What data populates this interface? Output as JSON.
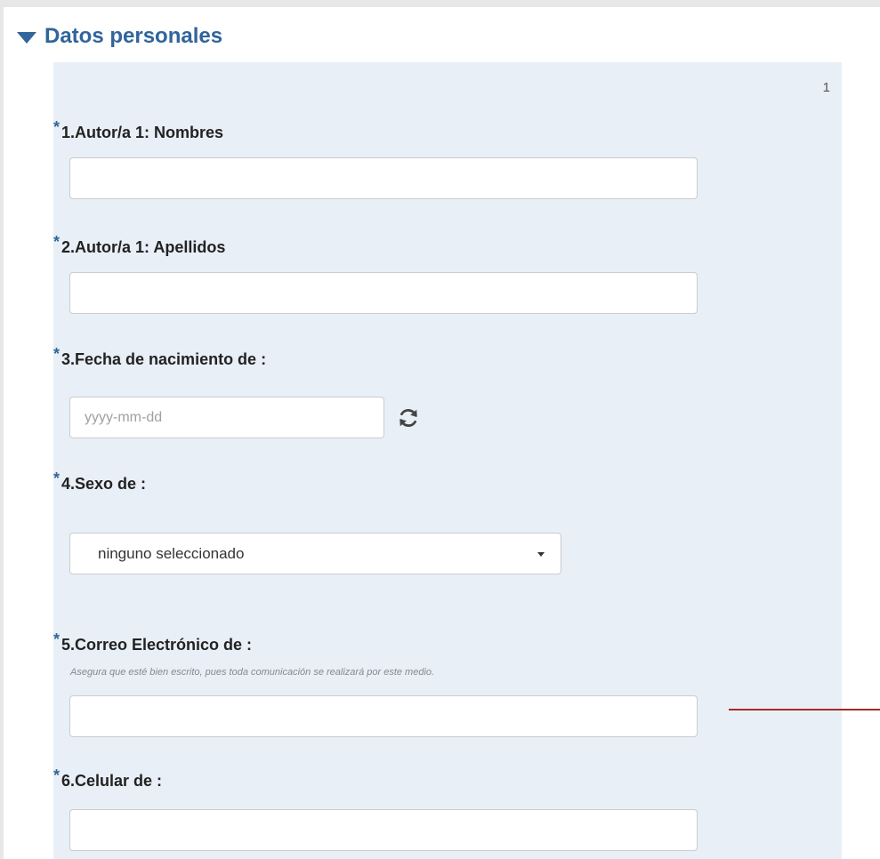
{
  "section": {
    "title": "Datos personales",
    "page_number": "1"
  },
  "questions": {
    "q1": {
      "marker": "*",
      "label": "1.Autor/a 1: Nombres",
      "value": ""
    },
    "q2": {
      "marker": "*",
      "label": "2.Autor/a 1: Apellidos",
      "value": ""
    },
    "q3": {
      "marker": "*",
      "label": "3.Fecha de nacimiento de :",
      "value": "",
      "placeholder": "yyyy-mm-dd"
    },
    "q4": {
      "marker": "*",
      "label": "4.Sexo de :",
      "selected": "ninguno seleccionado"
    },
    "q5": {
      "marker": "*",
      "label": "5.Correo Electrónico de :",
      "help": "Asegura que esté bien escrito, pues toda comunicación se realizará por este medio.",
      "value": ""
    },
    "q6": {
      "marker": "*",
      "label": "6.Celular de :",
      "value": ""
    }
  },
  "icons": {
    "section_toggle": "triangle-down-icon",
    "date_reset": "refresh-icon",
    "select_caret": "caret-down-icon"
  },
  "colors": {
    "page_bg": "#e7e7e7",
    "group_bg": "#e8eff7",
    "accent": "#336699",
    "annotation_line": "#a52a2a"
  }
}
